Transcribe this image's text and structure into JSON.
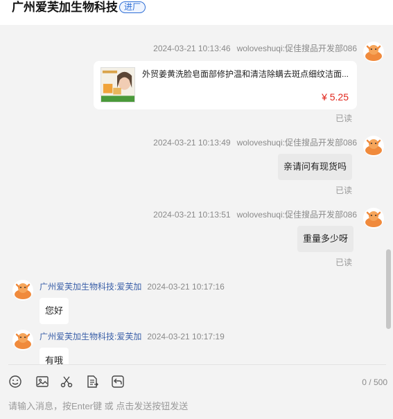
{
  "header": {
    "title": "广州爱芙加生物科技",
    "tag": "进厂"
  },
  "messages": [
    {
      "time": "2024-03-21 10:13:46",
      "sender": "woloveshuqi:促佳搜品开发部086",
      "product": {
        "title": "外贸姜黄洗脸皂面部修护温和清洁除螨去斑点细纹洁面...",
        "price": "¥ 5.25"
      },
      "status": "已读"
    },
    {
      "time": "2024-03-21 10:13:49",
      "sender": "woloveshuqi:促佳搜品开发部086",
      "text": "亲请问有现货吗",
      "status": "已读"
    },
    {
      "time": "2024-03-21 10:13:51",
      "sender": "woloveshuqi:促佳搜品开发部086",
      "text": "重量多少呀",
      "status": "已读"
    },
    {
      "time": "2024-03-21 10:17:16",
      "sender": "广州爱芙加生物科技:爱芙加",
      "text": "您好"
    },
    {
      "time": "2024-03-21 10:17:19",
      "sender": "广州爱芙加生物科技:爱芙加",
      "text": "有哦"
    }
  ],
  "toolbar": {
    "icons": [
      "emoji-icon",
      "image-icon",
      "scissors-icon",
      "document-icon",
      "history-icon"
    ],
    "counter": "0 / 500"
  },
  "input": {
    "placeholder": "请输入消息，按Enter键 或 点击发送按钮发送"
  },
  "colors": {
    "accent": "#2f6fd6",
    "price": "#e1251b",
    "avatar": "#f08a3c"
  }
}
